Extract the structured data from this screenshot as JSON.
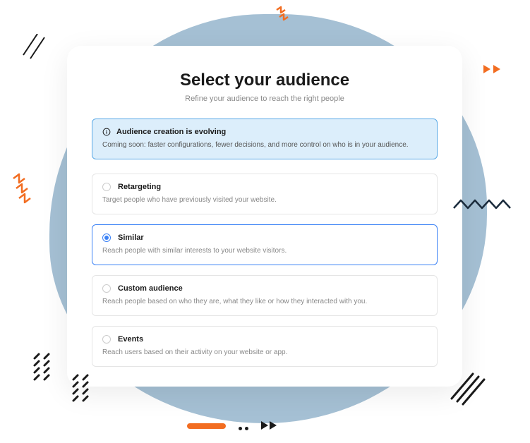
{
  "colors": {
    "accent_blue": "#3b82f6",
    "banner_bg": "#dceefb",
    "banner_border": "#5aa9e6",
    "orange": "#f26d21",
    "blob": "#a5c0d4"
  },
  "header": {
    "title": "Select your audience",
    "subtitle": "Refine your audience to reach the right people"
  },
  "banner": {
    "title": "Audience creation is evolving",
    "body": "Coming soon: faster configurations, fewer decisions, and more control on who is in your audience."
  },
  "options": [
    {
      "id": "retargeting",
      "title": "Retargeting",
      "desc": "Target people who have previously visited your website.",
      "selected": false
    },
    {
      "id": "similar",
      "title": "Similar",
      "desc": "Reach people with similar interests to your website visitors.",
      "selected": true
    },
    {
      "id": "custom",
      "title": "Custom audience",
      "desc": "Reach people based on who they are, what they like or how they interacted with you.",
      "selected": false
    },
    {
      "id": "events",
      "title": "Events",
      "desc": "Reach users based on their activity on your website or app.",
      "selected": false
    }
  ]
}
